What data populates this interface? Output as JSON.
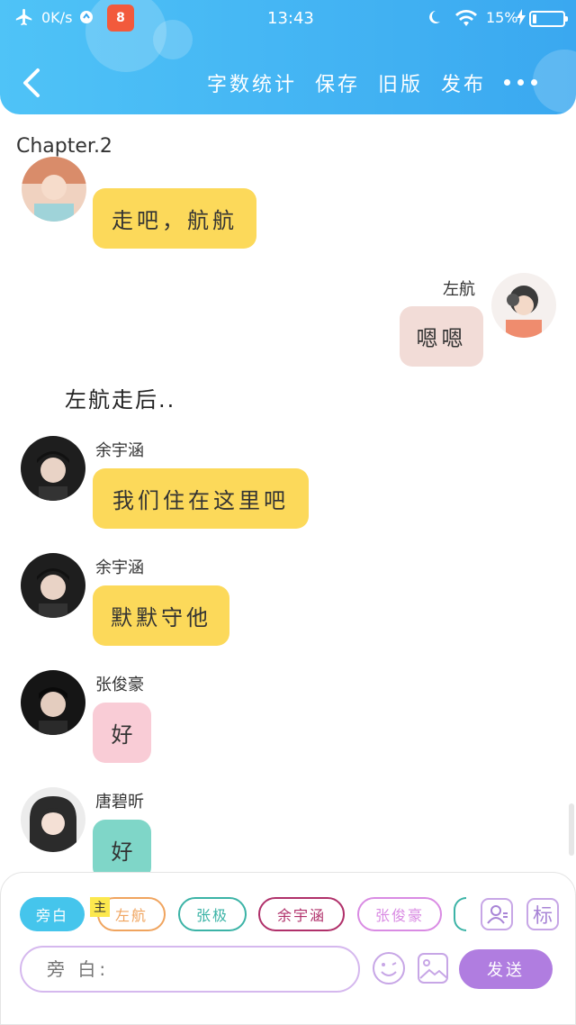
{
  "status_bar": {
    "speed": "0K/s",
    "time": "13:43",
    "battery": "15%",
    "app_badge": "8"
  },
  "nav": {
    "word_count": "字数统计",
    "save": "保存",
    "old_version": "旧版",
    "publish": "发布"
  },
  "chapter_title": "Chapter.2",
  "messages": [
    {
      "speaker": "",
      "text": "走吧，航航"
    },
    {
      "speaker": "左航",
      "text": "嗯嗯"
    },
    {
      "narration": "左航走后.."
    },
    {
      "speaker": "余宇涵",
      "text": "我们住在这里吧"
    },
    {
      "speaker": "余宇涵",
      "text": "默默守他"
    },
    {
      "speaker": "张俊豪",
      "text": "好"
    },
    {
      "speaker": "唐碧昕",
      "text": "好"
    }
  ],
  "input_panel": {
    "chips": [
      "旁白",
      "左航",
      "张极",
      "余宇涵",
      "张俊豪"
    ],
    "main_tag": "主",
    "mark_button": "标",
    "input_placeholder": "旁 白:",
    "send_label": "发送"
  },
  "colors": {
    "header": "#3aa8f0",
    "bubble_yellow": "#fcd95a",
    "bubble_beige": "#f2dcd7",
    "bubble_pink": "#f9ccd6",
    "bubble_teal": "#7fd6c8",
    "send": "#b07de0"
  }
}
